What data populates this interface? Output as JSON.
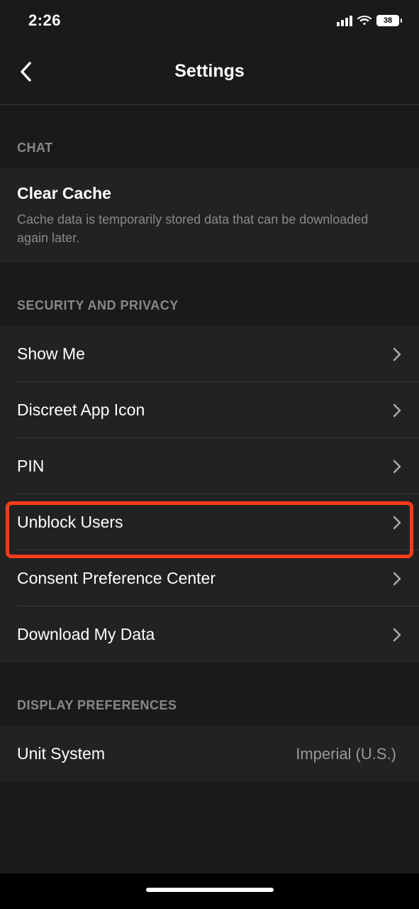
{
  "status": {
    "time": "2:26",
    "battery": "38"
  },
  "header": {
    "title": "Settings"
  },
  "sections": {
    "chat": {
      "header": "CHAT",
      "clear_cache": {
        "title": "Clear Cache",
        "desc": "Cache data is temporarily stored data that can be downloaded again later."
      }
    },
    "security": {
      "header": "SECURITY AND PRIVACY",
      "items": [
        {
          "label": "Show Me"
        },
        {
          "label": "Discreet App Icon"
        },
        {
          "label": "PIN"
        },
        {
          "label": "Unblock Users"
        },
        {
          "label": "Consent Preference Center"
        },
        {
          "label": "Download My Data"
        }
      ]
    },
    "display": {
      "header": "DISPLAY PREFERENCES",
      "unit_system": {
        "label": "Unit System",
        "value": "Imperial (U.S.)"
      }
    }
  }
}
